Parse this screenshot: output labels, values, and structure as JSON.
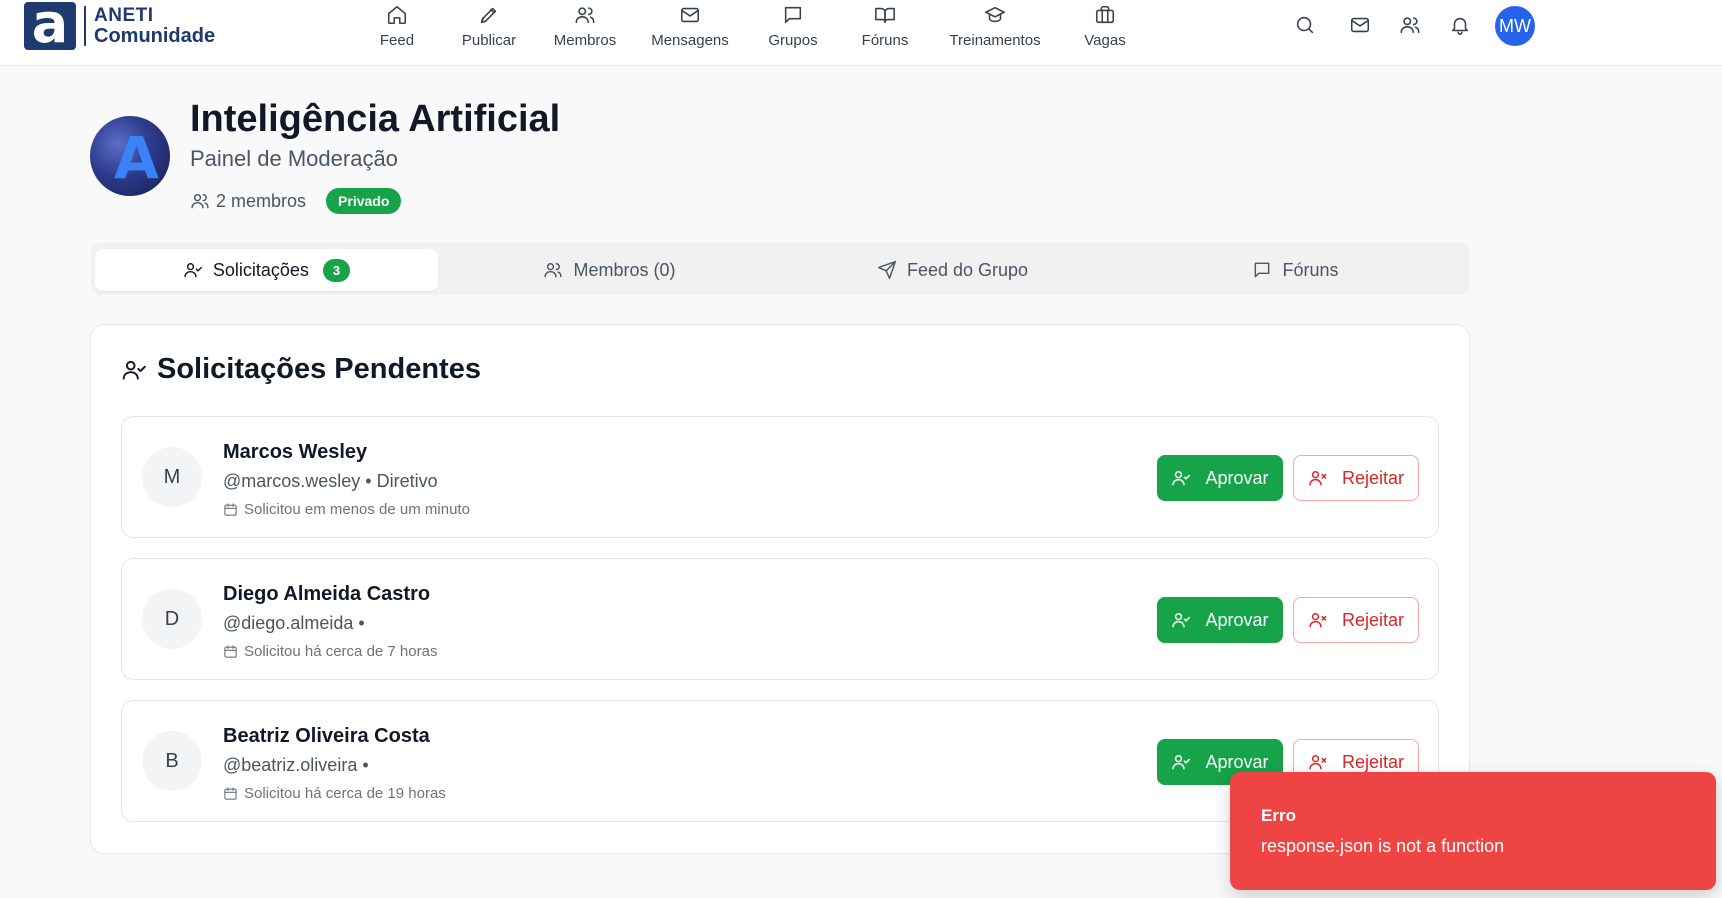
{
  "brand": {
    "mark": "a",
    "line1": "ANETI",
    "line2": "Comunidade"
  },
  "nav": {
    "items": [
      {
        "label": "Feed",
        "icon": "home-icon"
      },
      {
        "label": "Publicar",
        "icon": "pen-icon"
      },
      {
        "label": "Membros",
        "icon": "users-icon"
      },
      {
        "label": "Mensagens",
        "icon": "mail-icon"
      },
      {
        "label": "Grupos",
        "icon": "message-square-icon"
      },
      {
        "label": "Fóruns",
        "icon": "book-open-icon"
      },
      {
        "label": "Treinamentos",
        "icon": "graduation-cap-icon"
      },
      {
        "label": "Vagas",
        "icon": "briefcase-icon"
      }
    ]
  },
  "user": {
    "initials": "MW",
    "avatar_color": "#2563eb"
  },
  "group": {
    "name": "Inteligência Artificial",
    "subtitle": "Painel de Moderação",
    "members": "2 membros",
    "privacy": "Privado"
  },
  "tabs": [
    {
      "label": "Solicitações",
      "badge": "3",
      "icon": "user-check-icon",
      "active": true
    },
    {
      "label": "Membros (0)",
      "icon": "users-icon",
      "active": false
    },
    {
      "label": "Feed do Grupo",
      "icon": "send-icon",
      "active": false
    },
    {
      "label": "Fóruns",
      "icon": "message-square-icon",
      "active": false
    }
  ],
  "pending": {
    "title": "Solicitações Pendentes",
    "approve_label": "Aprovar",
    "reject_label": "Rejeitar",
    "requests": [
      {
        "initial": "M",
        "name": "Marcos Wesley",
        "handle": "@marcos.wesley • Diretivo",
        "requested": "Solicitou em menos de um minuto"
      },
      {
        "initial": "D",
        "name": "Diego Almeida Castro",
        "handle": "@diego.almeida •",
        "requested": "Solicitou há cerca de 7 horas"
      },
      {
        "initial": "B",
        "name": "Beatriz Oliveira Costa",
        "handle": "@beatriz.oliveira •",
        "requested": "Solicitou há cerca de 19 horas"
      }
    ]
  },
  "toast": {
    "title": "Erro",
    "message": "response.json is not a function",
    "color": "#ef4444"
  },
  "colors": {
    "approve": "#16a34a",
    "reject": "#dc2626",
    "brand": "#1e3a6e"
  }
}
